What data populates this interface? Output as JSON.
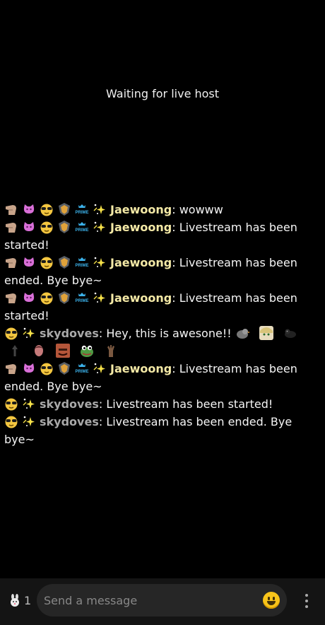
{
  "stream": {
    "status_text": "Waiting for live host"
  },
  "messages": [
    {
      "user": "Jaewoong",
      "style": "gold",
      "badges": [
        "hand-badge",
        "cat-badge",
        "sunglasses-badge",
        "shield-badge",
        "prime-badge",
        "sparkle-badge"
      ],
      "text": ": wowww"
    },
    {
      "user": "Jaewoong",
      "style": "gold",
      "badges": [
        "hand-badge",
        "cat-badge",
        "sunglasses-badge",
        "shield-badge",
        "prime-badge",
        "sparkle-badge"
      ],
      "text": ": Livestream has been started!"
    },
    {
      "user": "Jaewoong",
      "style": "gold",
      "badges": [
        "hand-badge",
        "cat-badge",
        "sunglasses-badge",
        "shield-badge",
        "prime-badge",
        "sparkle-badge"
      ],
      "text": ": Livestream has been ended. Bye bye~"
    },
    {
      "user": "Jaewoong",
      "style": "gold",
      "badges": [
        "hand-badge",
        "cat-badge",
        "sunglasses-badge",
        "shield-badge",
        "prime-badge",
        "sparkle-badge"
      ],
      "text": ": Livestream has been started!"
    },
    {
      "user": "skydoves",
      "style": "gray",
      "badges": [
        "sunglasses-badge",
        "sparkle-badge"
      ],
      "text": ": Hey, this is awesone!!",
      "emotes": [
        "bird-emote",
        "anime-emote",
        "crow-emote",
        "arrow-emote",
        "head-emote",
        "face-emote",
        "frog-emote",
        "hand-emote"
      ]
    },
    {
      "user": "Jaewoong",
      "style": "gold",
      "badges": [
        "hand-badge",
        "cat-badge",
        "sunglasses-badge",
        "shield-badge",
        "prime-badge",
        "sparkle-badge"
      ],
      "text": ": Livestream has been ended. Bye bye~"
    },
    {
      "user": "skydoves",
      "style": "gray",
      "badges": [
        "sunglasses-badge",
        "sparkle-badge"
      ],
      "text": ": Livestream has been started!"
    },
    {
      "user": "skydoves",
      "style": "gray",
      "badges": [
        "sunglasses-badge",
        "sparkle-badge"
      ],
      "text": ": Livestream has been ended. Bye bye~"
    }
  ],
  "input_bar": {
    "viewer_count": "1",
    "placeholder": "Send a message"
  },
  "colors": {
    "nick_gold": "#f4e9a6",
    "nick_gray": "#a9a9a9",
    "background": "#000000"
  }
}
